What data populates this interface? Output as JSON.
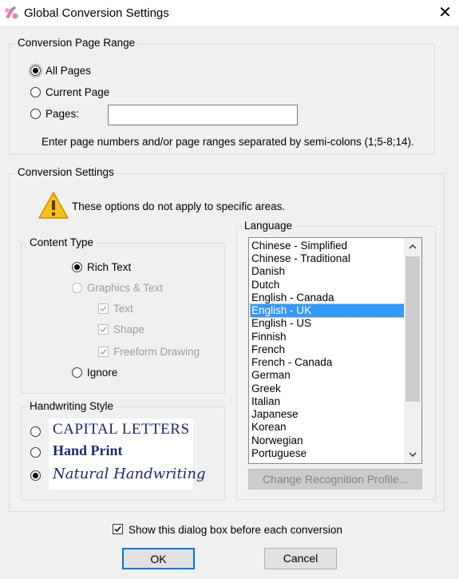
{
  "window": {
    "title": "Global Conversion Settings",
    "close": "✕"
  },
  "page_range": {
    "legend": "Conversion Page Range",
    "options": [
      "All Pages",
      "Current Page",
      "Pages:"
    ],
    "pages_value": "",
    "hint": "Enter page numbers and/or page ranges separated by semi-colons (1;5-8;14)."
  },
  "settings": {
    "legend": "Conversion Settings",
    "warning": "These options do not apply to specific areas."
  },
  "content_type": {
    "legend": "Content Type",
    "rich_text": "Rich Text",
    "graphics_text": "Graphics & Text",
    "text": "Text",
    "shape": "Shape",
    "freeform": "Freeform Drawing",
    "ignore": "Ignore"
  },
  "handwriting": {
    "legend": "Handwriting Style",
    "capital": "CAPITAL LETTERS",
    "print": "Hand Print",
    "natural": "Natural Handwriting"
  },
  "language": {
    "legend": "Language",
    "items": [
      "Chinese - Simplified",
      "Chinese - Traditional",
      "Danish",
      "Dutch",
      "English - Canada",
      "English - UK",
      "English - US",
      "Finnish",
      "French",
      "French - Canada",
      "German",
      "Greek",
      "Italian",
      "Japanese",
      "Korean",
      "Norwegian",
      "Portuguese"
    ],
    "selected": "English - UK",
    "profile_button": "Change Recognition Profile..."
  },
  "footer": {
    "show_dialog": "Show this dialog box before each conversion",
    "ok": "OK",
    "cancel": "Cancel"
  },
  "colors": {
    "selection": "#3399ff",
    "focus_border": "#0078d7",
    "handwriting_ink": "#1c2a6b"
  }
}
